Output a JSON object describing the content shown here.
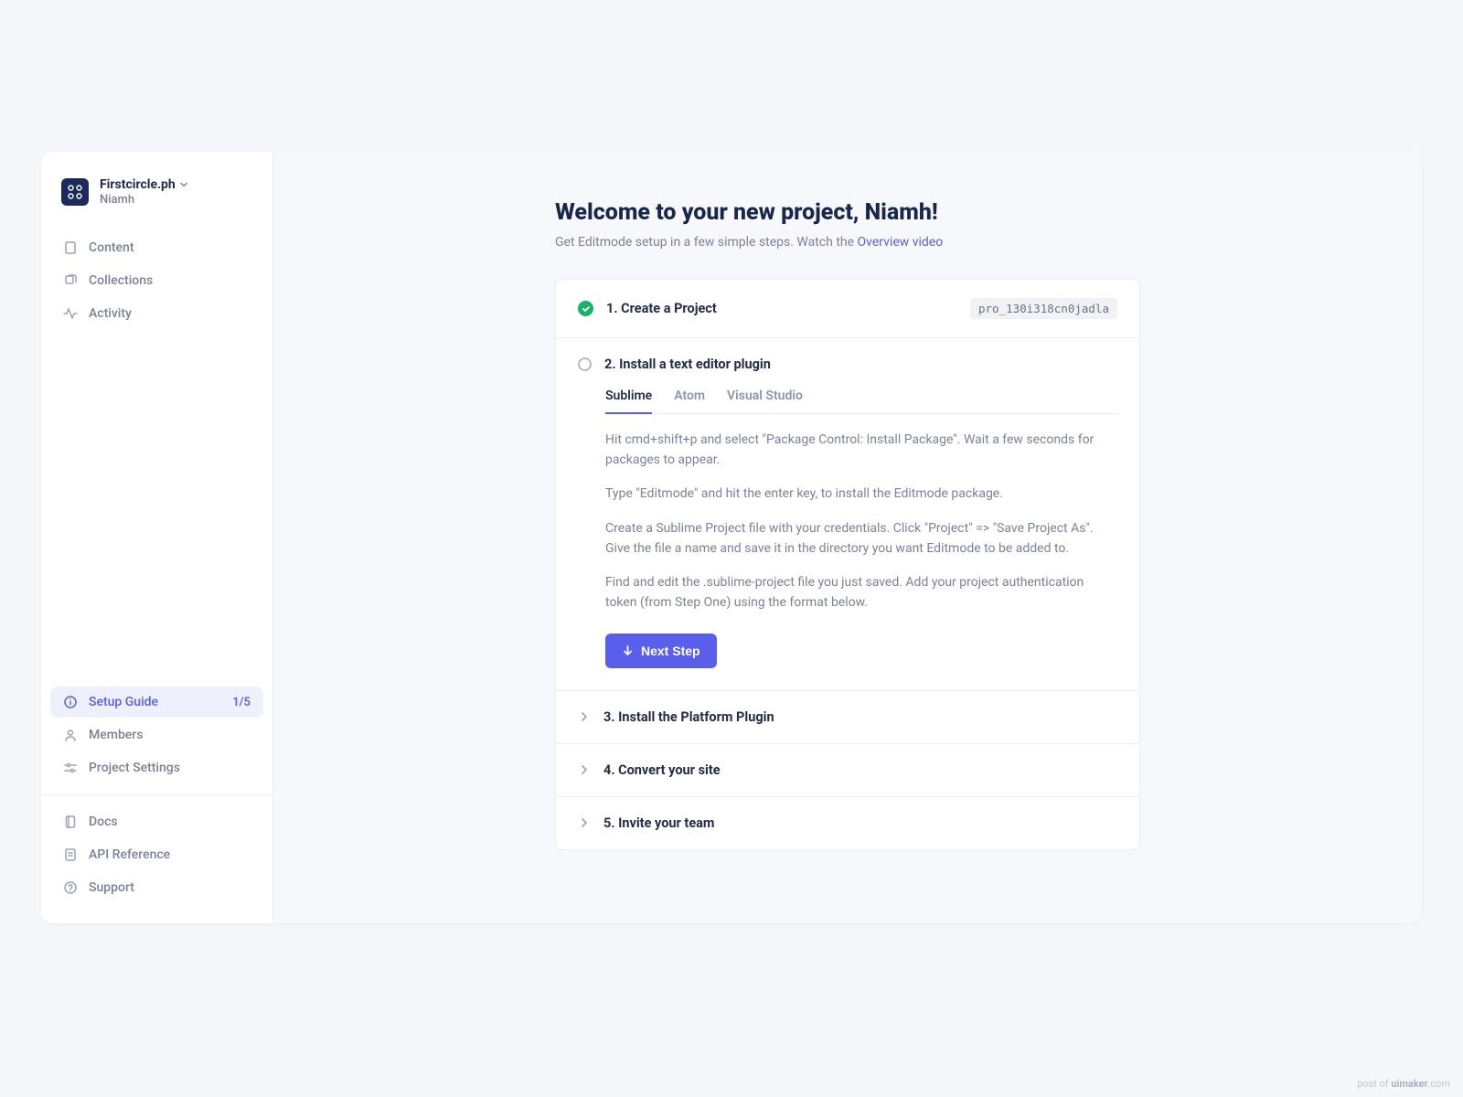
{
  "workspace": {
    "name": "Firstcircle.ph",
    "user": "Niamh"
  },
  "sidebar": {
    "nav_top": {
      "content": "Content",
      "collections": "Collections",
      "activity": "Activity"
    },
    "nav_mid": {
      "setup_guide": "Setup Guide",
      "setup_guide_badge": "1/5",
      "members": "Members",
      "project_settings": "Project Settings"
    },
    "nav_bottom": {
      "docs": "Docs",
      "api_reference": "API Reference",
      "support": "Support"
    }
  },
  "main": {
    "title": "Welcome to your new project, Niamh!",
    "subtitle_prefix": "Get Editmode setup in a few simple steps. Watch the ",
    "subtitle_link": "Overview video"
  },
  "steps": {
    "s1": {
      "title": "1. Create a Project",
      "code": "pro_130i318cn0jadla"
    },
    "s2": {
      "title": "2. Install a text editor plugin",
      "tabs": {
        "sublime": "Sublime",
        "atom": "Atom",
        "vs": "Visual Studio"
      },
      "p1": "Hit cmd+shift+p and select \"Package Control: Install Package\". Wait a few seconds for packages to appear.",
      "p2": "Type \"Editmode\" and hit the enter key, to install the Editmode package.",
      "p3": "Create a Sublime Project file with your credentials. Click \"Project\" => \"Save Project As\". Give the file a name and save it in the directory you want Editmode to be added to.",
      "p4": "Find and edit the .sublime-project file you just saved. Add your project authentication token (from Step One) using the format below.",
      "next_button": "Next Step"
    },
    "s3": {
      "title": "3. Install the Platform Plugin"
    },
    "s4": {
      "title": "4. Convert your site"
    },
    "s5": {
      "title": "5. Invite your team"
    }
  },
  "credit": {
    "prefix": "post of ",
    "brand": "uimaker",
    "suffix": ".com"
  }
}
